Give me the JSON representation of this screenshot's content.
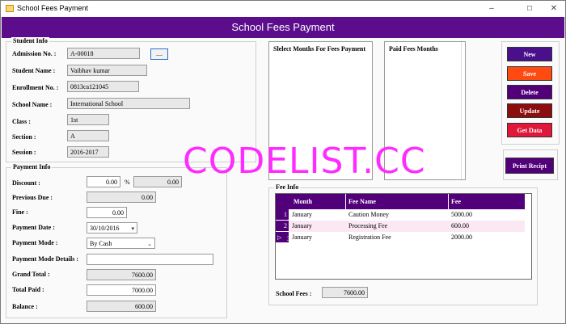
{
  "window": {
    "title": "School Fees Payment",
    "minimize": "–",
    "maximize": "☐",
    "close": "✕"
  },
  "header": {
    "title": "School Fees Payment"
  },
  "student_info": {
    "legend": "Student Info",
    "admission_label": "Admission No. :",
    "admission_value": "A-00018",
    "browse_button": "....",
    "student_name_label": "Student Name :",
    "student_name_value": "Vaibhav kumar",
    "enrollment_label": "Enrollment No. :",
    "enrollment_value": "0813ca121045",
    "school_name_label": "School Name :",
    "school_name_value": "International School",
    "class_label": "Class :",
    "class_value": "1st",
    "section_label": "Section :",
    "section_value": "A",
    "session_label": "Session :",
    "session_value": "2016-2017"
  },
  "payment_info": {
    "legend": "Payment Info",
    "discount_label": "Discount :",
    "discount_value": "0.00",
    "percent_sign": "%",
    "discount_amount": "0.00",
    "previous_due_label": "Previous Due :",
    "previous_due_value": "0.00",
    "fine_label": "Fine :",
    "fine_value": "0.00",
    "payment_date_label": "Payment Date :",
    "payment_date_value": "30/10/2016",
    "payment_mode_label": "Payment Mode :",
    "payment_mode_value": "By Cash",
    "payment_mode_details_label": "Payment Mode Details :",
    "payment_mode_details_value": "",
    "grand_total_label": "Grand Total :",
    "grand_total_value": "7600.00",
    "total_paid_label": "Total Paid :",
    "total_paid_value": "7000.00",
    "balance_label": "Balance :",
    "balance_value": "600.00"
  },
  "months": {
    "select_header": "Slelect Months For Fees Payment",
    "paid_header": "Paid Fees Months"
  },
  "actions": {
    "new": "New",
    "save": "Save",
    "delete": "Delete",
    "update": "Update",
    "get_data": "Get Data",
    "print": "Print Recipt"
  },
  "fee_info": {
    "legend": "Fee Info",
    "columns": [
      "Month",
      "Fee Name",
      "Fee"
    ],
    "rows": [
      {
        "num": "1",
        "month": "January",
        "fee_name": "Caution  Money",
        "fee": "5000.00"
      },
      {
        "num": "2",
        "month": "January",
        "fee_name": "Processing Fee",
        "fee": "600.00"
      },
      {
        "num": "3",
        "month": "January",
        "fee_name": "Registration Fee",
        "fee": "2000.00"
      }
    ],
    "school_fees_label": "School Fees :",
    "school_fees_value": "7600.00"
  },
  "watermark": "CODELIST.CC",
  "colors": {
    "header": "#5b0d8c",
    "new": "#4a0f8a",
    "save": "#ff4a12",
    "delete": "#520079",
    "update": "#8c0d0d",
    "get_data": "#e0163a",
    "print": "#520079"
  }
}
